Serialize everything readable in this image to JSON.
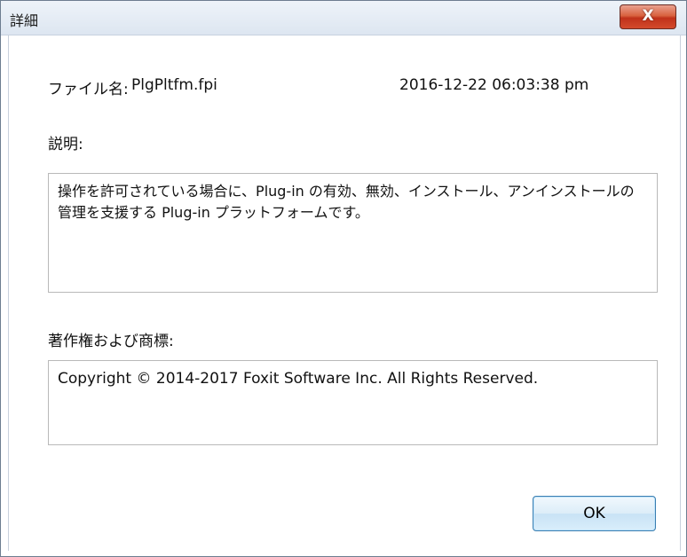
{
  "window": {
    "title": "詳細",
    "close_label": "X"
  },
  "file": {
    "name_label": "ファイル名:",
    "name_value": "PlgPltfm.fpi",
    "timestamp": "2016-12-22 06:03:38 pm"
  },
  "description": {
    "label": "説明:",
    "text_line1": "操作を許可されている場合に、Plug-in の有効、無効、インストール、アンインストールの",
    "text_line2": "管理を支援する Plug-in プラットフォームです。"
  },
  "copyright": {
    "label": "著作権および商標:",
    "text": "Copyright © 2014-2017 Foxit Software Inc. All Rights Reserved."
  },
  "buttons": {
    "ok_label": "OK"
  }
}
